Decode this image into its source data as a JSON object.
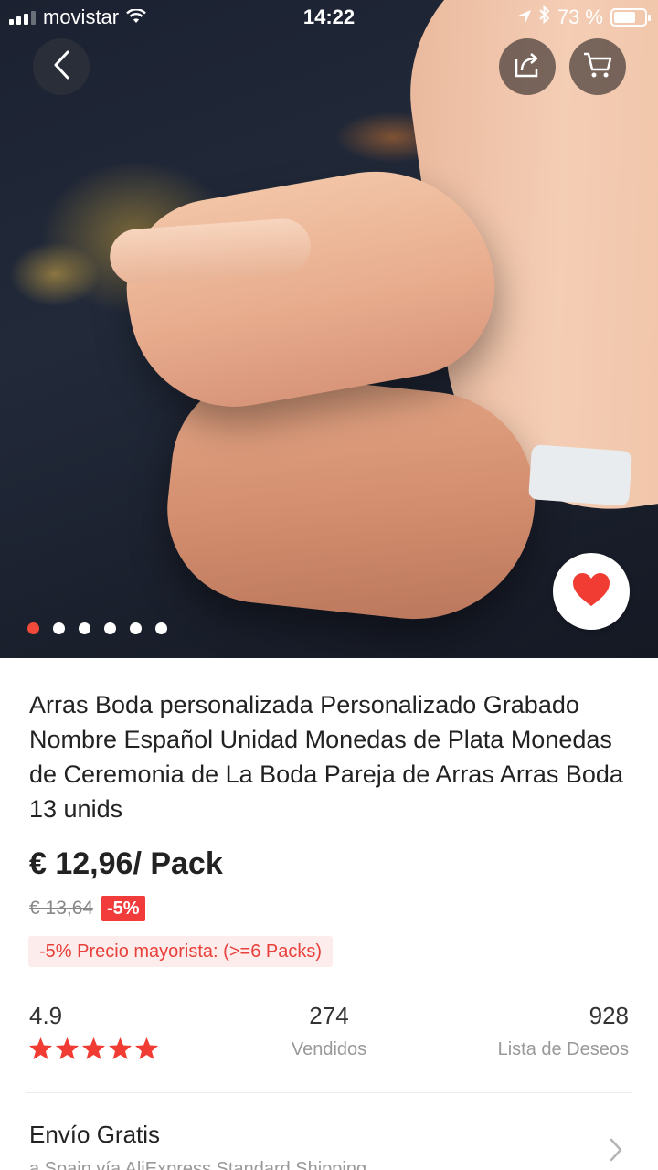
{
  "status_bar": {
    "carrier": "movistar",
    "time": "14:22",
    "battery": "73 %",
    "battery_level": 0.73
  },
  "gallery": {
    "image_count": 6,
    "active_index": 0
  },
  "product": {
    "title": "Arras Boda personalizada Personalizado Grabado Nombre Español Unidad Monedas de Plata Monedas de Ceremonia de La Boda Pareja de Arras Arras Boda 13 unids",
    "price": "€ 12,96/ Pack",
    "original_price": "€ 13,64",
    "discount": "-5%",
    "bulk_offer": "-5% Precio mayorista: (>=6 Packs)"
  },
  "stats": {
    "rating": "4.9",
    "stars": 5,
    "sold_count": "274",
    "sold_label": "Vendidos",
    "wishlist_count": "928",
    "wishlist_label": "Lista de Deseos"
  },
  "shipping": {
    "title": "Envío Gratis",
    "subtitle": "a Spain vía AliExpress Standard Shipping"
  },
  "colors": {
    "accent": "#f23b3b",
    "star": "#f03c32"
  }
}
